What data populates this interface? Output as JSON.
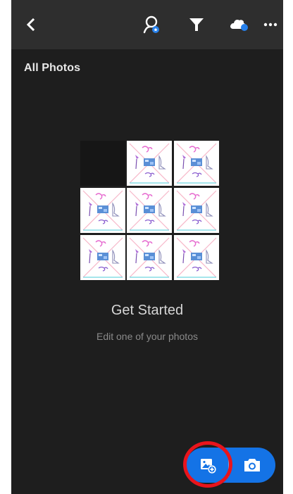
{
  "topbar": {
    "back_icon": "chevron-left-icon",
    "people_icon": "people-search-icon",
    "filter_icon": "filter-funnel-icon",
    "cloud_icon": "cloud-sync-icon",
    "more_icon": "more-ellipsis-icon"
  },
  "page": {
    "title": "All Photos"
  },
  "empty_state": {
    "heading": "Get Started",
    "subtext": "Edit one of your photos",
    "thumbnail_count_visible": 8
  },
  "fab": {
    "add_icon": "add-photo-icon",
    "camera_icon": "camera-icon"
  },
  "colors": {
    "background": "#1e1e1e",
    "topbar": "#2e2e2e",
    "accent": "#1473e6",
    "badge": "#2680eb",
    "highlight": "#e8141c"
  }
}
